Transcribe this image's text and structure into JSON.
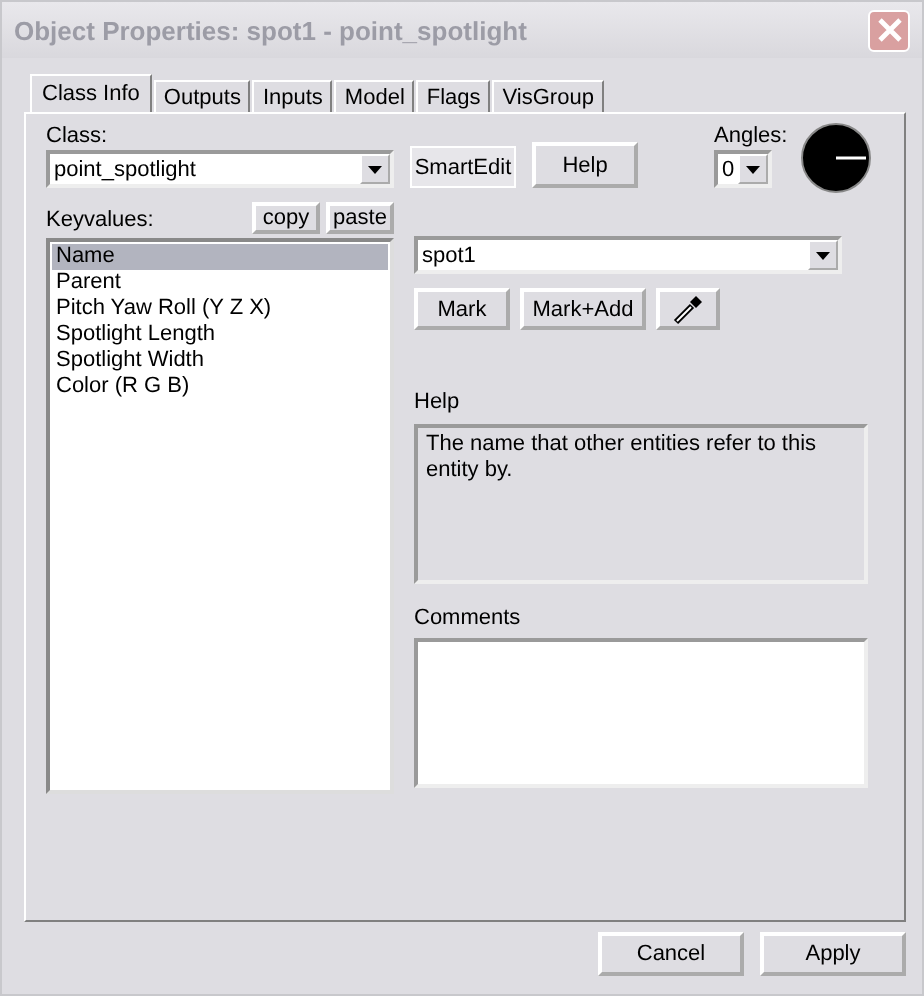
{
  "window": {
    "title": "Object Properties: spot1 - point_spotlight"
  },
  "tabs": [
    {
      "label": "Class Info",
      "selected": true
    },
    {
      "label": "Outputs",
      "selected": false
    },
    {
      "label": "Inputs",
      "selected": false
    },
    {
      "label": "Model",
      "selected": false
    },
    {
      "label": "Flags",
      "selected": false
    },
    {
      "label": "VisGroup",
      "selected": false
    }
  ],
  "class_info": {
    "class_label": "Class:",
    "class_value": "point_spotlight",
    "smartedit": {
      "label": "SmartEdit",
      "on": true
    },
    "help_button": "Help",
    "angles_label": "Angles:",
    "angles_value": "0",
    "keyvalues_label": "Keyvalues:",
    "copy_button": "copy",
    "paste_button": "paste",
    "keyvalues": [
      {
        "name": "Name",
        "selected": true
      },
      {
        "name": "Parent",
        "selected": false
      },
      {
        "name": "Pitch Yaw Roll (Y Z X)",
        "selected": false
      },
      {
        "name": "Spotlight Length",
        "selected": false
      },
      {
        "name": "Spotlight Width",
        "selected": false
      },
      {
        "name": "Color (R G B)",
        "selected": false
      }
    ],
    "value": "spot1",
    "mark_button": "Mark",
    "mark_add_button": "Mark+Add",
    "help_label": "Help",
    "help_text": "The name that other entities refer to this entity by.",
    "comments_label": "Comments"
  },
  "buttons": [
    {
      "label": "Cancel"
    },
    {
      "label": "Apply"
    }
  ]
}
